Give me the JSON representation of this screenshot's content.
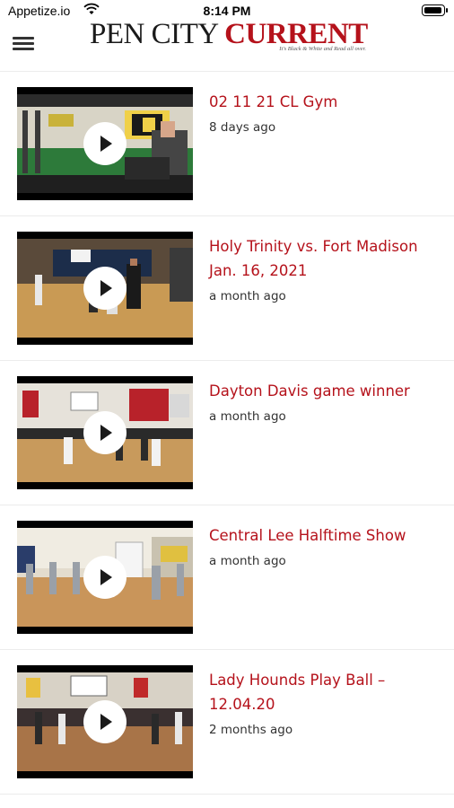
{
  "status_bar": {
    "carrier": "Appetize.io",
    "time": "8:14 PM"
  },
  "header": {
    "logo_part1": "PEN CITY ",
    "logo_part2": "CURRENT",
    "tagline": "It's Black & White and Read all over."
  },
  "colors": {
    "accent": "#b5121b",
    "text_secondary": "#333333"
  },
  "videos": [
    {
      "title": "02 11 21 CL Gym",
      "age": "8 days ago",
      "thumbnail": "gym-weightroom"
    },
    {
      "title": "Holy Trinity vs. Fort Madison Jan. 16, 2021",
      "age": "a month ago",
      "thumbnail": "basketball-game"
    },
    {
      "title": "Dayton Davis game winner",
      "age": "a month ago",
      "thumbnail": "basketball-game"
    },
    {
      "title": "Central Lee Halftime Show",
      "age": "a month ago",
      "thumbnail": "halftime-dance"
    },
    {
      "title": "Lady Hounds Play Ball – 12.04.20",
      "age": "2 months ago",
      "thumbnail": "basketball-game"
    }
  ]
}
